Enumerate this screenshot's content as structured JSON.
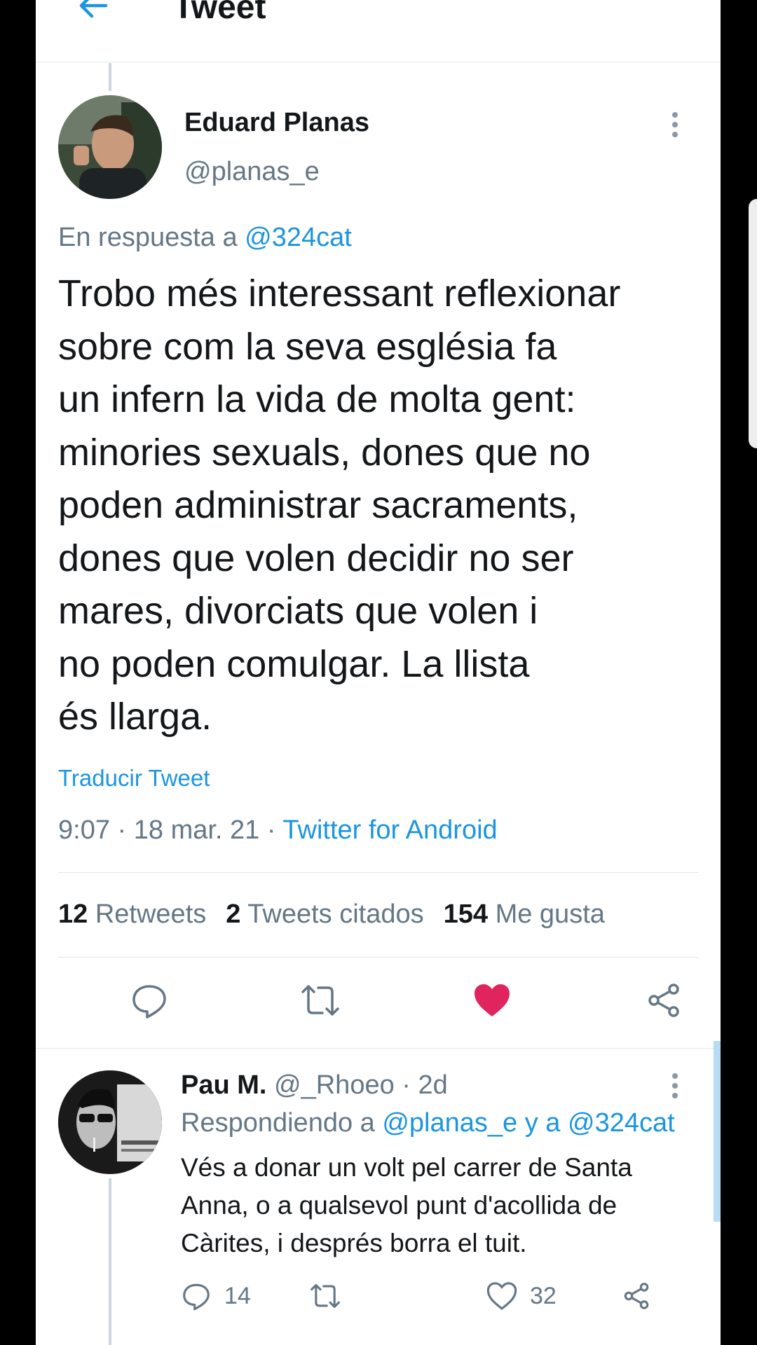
{
  "header": {
    "title": "Tweet"
  },
  "main_tweet": {
    "author_name": "Eduard Planas",
    "author_handle": "@planas_e",
    "reply_prefix": "En respuesta a",
    "reply_mention": "@324cat",
    "text_lines": [
      "Trobo més interessant reflexionar",
      "sobre com la seva església fa",
      "un infern la vida de molta gent:",
      "minories sexuals, dones que no",
      "poden administrar sacraments,",
      "dones que volen decidir no ser",
      "mares, divorciats que volen i",
      "no poden comulgar. La llista",
      "és llarga."
    ],
    "translate_label": "Traducir Tweet",
    "time": "9:07",
    "date": "18 mar. 21",
    "dot": "·",
    "client": "Twitter for Android",
    "stats": {
      "retweets_count": "12",
      "retweets_label": "Retweets",
      "quotes_count": "2",
      "quotes_label": "Tweets citados",
      "likes_count": "154",
      "likes_label": "Me gusta"
    },
    "liked": true,
    "like_color": "#e0245e"
  },
  "reply_tweet": {
    "author_name": "Pau M.",
    "author_handle": "@_Rhoeo",
    "dot": "·",
    "age": "2d",
    "reply_prefix": "Respondiendo a",
    "mention1": "@planas_e",
    "conj": "y a",
    "mention2": "@324cat",
    "text_lines": [
      "Vés a donar un volt pel carrer de Santa",
      "Anna, o a qualsevol punt d'acollida de",
      "Càrites, i després borra el tuit."
    ],
    "reply_count": "14",
    "like_count": "32"
  },
  "colors": {
    "accent": "#1b95e0",
    "muted": "#657786",
    "text": "#14171a",
    "like": "#e0245e"
  },
  "icons": [
    "back-arrow-icon",
    "more-vertical-icon",
    "reply-icon",
    "retweet-icon",
    "heart-icon",
    "share-icon"
  ]
}
